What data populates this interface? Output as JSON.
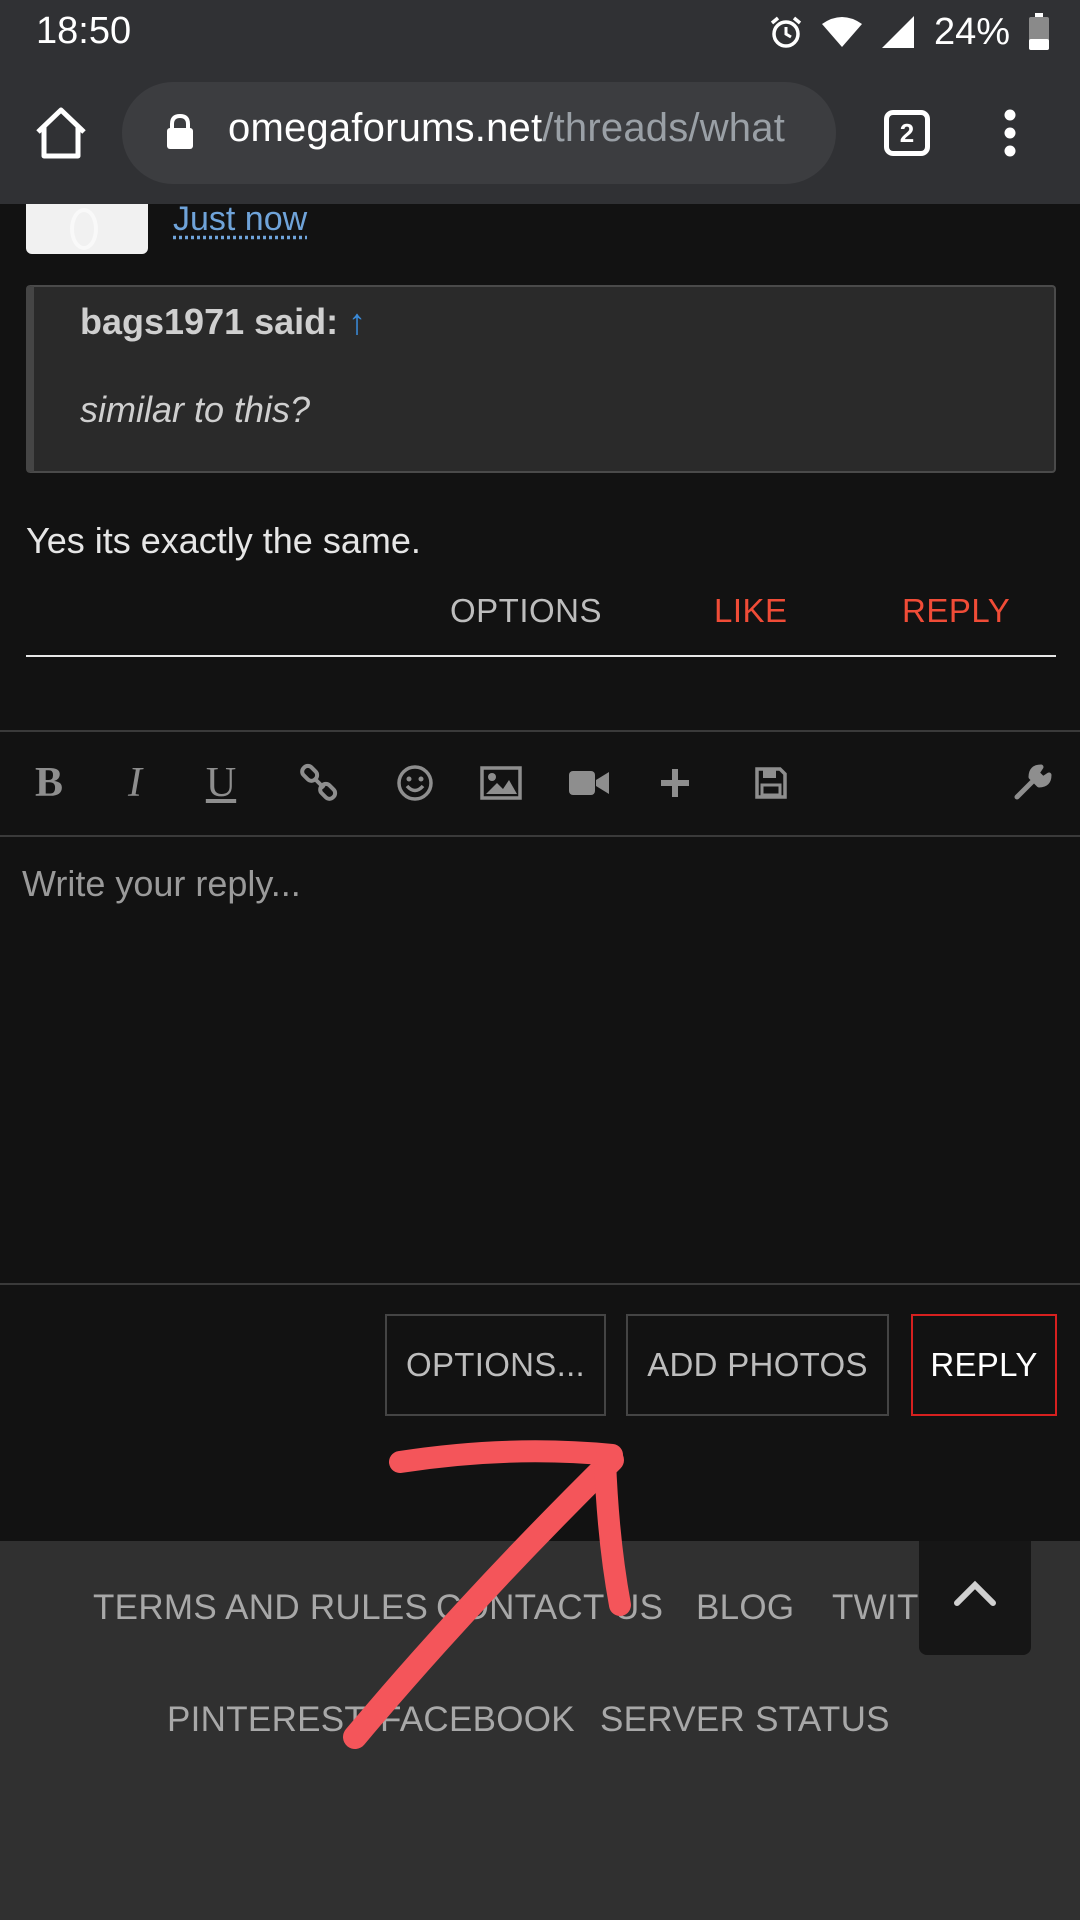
{
  "status_bar": {
    "time": "18:50",
    "battery_percent": "24%",
    "icons": [
      "alarm-icon",
      "wifi-icon",
      "signal-icon",
      "battery-icon"
    ]
  },
  "browser": {
    "url_domain": "omegaforums.net",
    "url_path": "/threads/what",
    "tab_count": "2",
    "icons": [
      "home-icon",
      "lock-icon",
      "tabs-icon",
      "more-vert-icon"
    ]
  },
  "post": {
    "timestamp": "Just now",
    "quote": {
      "author": "bags1971 said:",
      "arrow": "↑",
      "text": "similar to this?"
    },
    "message": "Yes its exactly the same.",
    "actions": {
      "options": "OPTIONS",
      "like": "LIKE",
      "reply": "REPLY"
    }
  },
  "editor": {
    "toolbar_icons": [
      "bold-icon",
      "italic-icon",
      "underline-icon",
      "link-icon",
      "smiley-icon",
      "image-icon",
      "video-icon",
      "plus-icon",
      "save-icon",
      "wrench-icon"
    ],
    "toolbar_letters": {
      "bold": "B",
      "italic": "I",
      "underline": "U"
    },
    "placeholder": "Write your reply..."
  },
  "form_buttons": {
    "options": "OPTIONS...",
    "add_photos": "ADD PHOTOS",
    "reply": "REPLY"
  },
  "footer": {
    "links_row1": [
      "TERMS AND RULES",
      "CONTACT US",
      "BLOG",
      "TWITT"
    ],
    "links_row2": [
      "PINTEREST",
      "FACEBOOK",
      "SERVER STATUS"
    ]
  },
  "colors": {
    "accent_red": "#f04c37",
    "reply_border": "#d6201f",
    "link_blue": "#6fa3d9",
    "annotation_red": "#f4555a"
  }
}
